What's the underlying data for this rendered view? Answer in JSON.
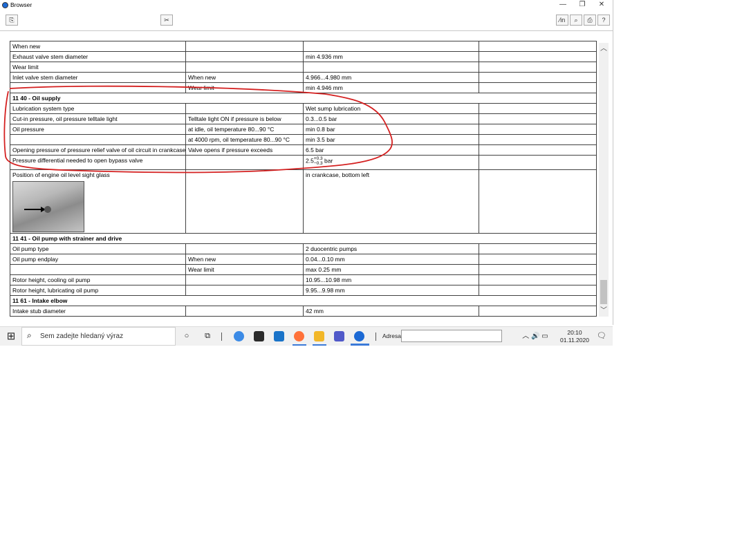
{
  "window": {
    "title": "Browser",
    "controls": {
      "minimize": "—",
      "restore": "❐",
      "close": "✕"
    }
  },
  "toolbar": {
    "left_button": "⎘",
    "mid_button": "✂",
    "right_buttons": [
      "⁄in",
      "⌕",
      "⎙",
      "?"
    ]
  },
  "table": {
    "rows": [
      {
        "type": "row",
        "c1": "When new",
        "c2": "",
        "c3": "",
        "c4": ""
      },
      {
        "type": "row",
        "c1": "Exhaust valve stem diameter",
        "c2": "",
        "c3": "min 4.936 mm",
        "c4": ""
      },
      {
        "type": "row",
        "c1": "Wear limit",
        "c2": "",
        "c3": "",
        "c4": ""
      },
      {
        "type": "row",
        "c1": "Inlet valve stem diameter",
        "c2": "When new",
        "c3": "4.966...4.980 mm",
        "c4": ""
      },
      {
        "type": "row",
        "c1": "",
        "c2": "Wear limit",
        "c3": "min 4.946 mm",
        "c4": ""
      },
      {
        "type": "section",
        "c1": "11 40 - Oil supply"
      },
      {
        "type": "row",
        "c1": "Lubrication system type",
        "c2": "",
        "c3": "Wet sump lubrication",
        "c4": ""
      },
      {
        "type": "row",
        "c1": "Cut-in pressure, oil pressure telltale light",
        "c2": "Telltale light ON if pressure is below",
        "c3": "0.3...0.5 bar",
        "c4": ""
      },
      {
        "type": "row",
        "c1": "Oil pressure",
        "c2": "at idle, oil temperature 80...90 °C",
        "c3": "min 0.8 bar",
        "c4": ""
      },
      {
        "type": "row",
        "c1": "",
        "c2": "at 4000 rpm, oil temperature 80...90 °C",
        "c3": "min 3.5 bar",
        "c4": ""
      },
      {
        "type": "row",
        "c1": "Opening pressure of pressure relief valve of oil circuit in crankcase",
        "c2": "Valve opens if pressure exceeds",
        "c3": "6.5 bar",
        "c4": ""
      },
      {
        "type": "row_tol",
        "c1": "Pressure differential needed to open bypass valve",
        "c2": "",
        "c3_base": "2.5",
        "c3_sup": "+0.3",
        "c3_sub": "−0.3",
        "c3_unit": " bar",
        "c4": ""
      },
      {
        "type": "row_img",
        "c1": "Position of engine oil level sight glass",
        "c2": "",
        "c3": "in crankcase, bottom left",
        "c4": ""
      },
      {
        "type": "section",
        "c1": "11 41 - Oil pump with strainer and drive"
      },
      {
        "type": "row",
        "c1": "Oil pump type",
        "c2": "",
        "c3": "2 duocentric pumps",
        "c4": ""
      },
      {
        "type": "row",
        "c1": "Oil pump endplay",
        "c2": "When new",
        "c3": "0.04...0.10 mm",
        "c4": ""
      },
      {
        "type": "row",
        "c1": "",
        "c2": "Wear limit",
        "c3": "max 0.25 mm",
        "c4": ""
      },
      {
        "type": "row",
        "c1": "Rotor height, cooling oil pump",
        "c2": "",
        "c3": "10.95...10.98 mm",
        "c4": ""
      },
      {
        "type": "row",
        "c1": "Rotor height, lubricating oil pump",
        "c2": "",
        "c3": "9.95...9.98 mm",
        "c4": ""
      },
      {
        "type": "section",
        "c1": "11 61 - Intake elbow"
      },
      {
        "type": "row",
        "c1": "Intake stub diameter",
        "c2": "",
        "c3": "42 mm",
        "c4": ""
      }
    ]
  },
  "scrollbar": {
    "up": "︿",
    "down": "﹀"
  },
  "annotation": {
    "color": "#d42020"
  },
  "taskbar": {
    "start_glyph": "⊞",
    "search_placeholder": "Sem zadejte hledaný výraz",
    "search_glyph": "⌕",
    "cortana_glyph": "○",
    "taskview_glyph": "⧉",
    "address_label": "Adresa",
    "address_value": "",
    "tray_glyphs": "︿ 🔊 ▭",
    "time": "20:10",
    "date": "01.11.2020",
    "notification_glyph": "🗨"
  },
  "colors": {
    "chrome": "#3c8be6",
    "store": "#2b2b2b",
    "mail": "#1a73c8",
    "firefox": "#ff7139",
    "explorer": "#f2b728",
    "teams": "#5059c9",
    "bmw": "#1c69d4"
  }
}
